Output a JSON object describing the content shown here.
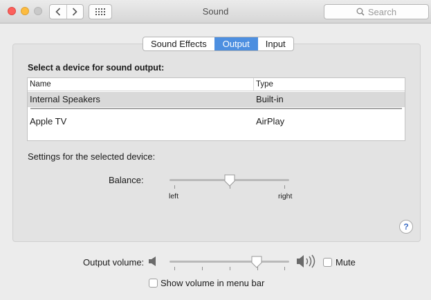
{
  "window": {
    "title": "Sound"
  },
  "search": {
    "placeholder": "Search"
  },
  "tabs": [
    {
      "label": "Sound Effects",
      "active": false
    },
    {
      "label": "Output",
      "active": true
    },
    {
      "label": "Input",
      "active": false
    }
  ],
  "output": {
    "section_title": "Select a device for sound output:",
    "columns": {
      "name": "Name",
      "type": "Type"
    },
    "devices": [
      {
        "name": "Internal Speakers",
        "type": "Built-in",
        "selected": true
      },
      {
        "name": "Apple TV",
        "type": "AirPlay",
        "selected": false
      }
    ],
    "settings_label": "Settings for the selected device:",
    "balance": {
      "label": "Balance:",
      "left_label": "left",
      "right_label": "right",
      "value": 0.5
    }
  },
  "volume": {
    "label": "Output volume:",
    "value": 0.73,
    "mute_label": "Mute",
    "mute_checked": false,
    "show_in_menu_bar_label": "Show volume in menu bar",
    "show_in_menu_bar_checked": false
  },
  "help": {
    "label": "?"
  },
  "colors": {
    "accent": "#4d8fe0",
    "selected_row": "#d9d9d9"
  },
  "icons": [
    "chevron-left-icon",
    "chevron-right-icon",
    "grid-icon",
    "search-icon",
    "speaker-low-icon",
    "speaker-high-icon"
  ]
}
